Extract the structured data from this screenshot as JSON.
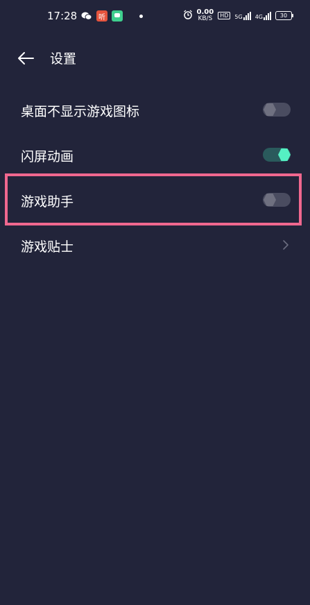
{
  "status_bar": {
    "time": "17:28",
    "ting_label": "听",
    "net_speed_value": "0.00",
    "net_speed_unit": "KB/S",
    "hd_label": "HD",
    "sim1_label": "5G",
    "sim2_label": "4G",
    "battery": "30"
  },
  "header": {
    "title": "设置"
  },
  "settings": {
    "items": [
      {
        "label": "桌面不显示游戏图标",
        "control": "toggle",
        "state": "off"
      },
      {
        "label": "闪屏动画",
        "control": "toggle",
        "state": "on"
      },
      {
        "label": "游戏助手",
        "control": "toggle",
        "state": "off"
      },
      {
        "label": "游戏贴士",
        "control": "chevron"
      }
    ]
  },
  "colors": {
    "background": "#22243a",
    "toggle_on": "#55f0c3",
    "highlight": "#f0688f"
  }
}
